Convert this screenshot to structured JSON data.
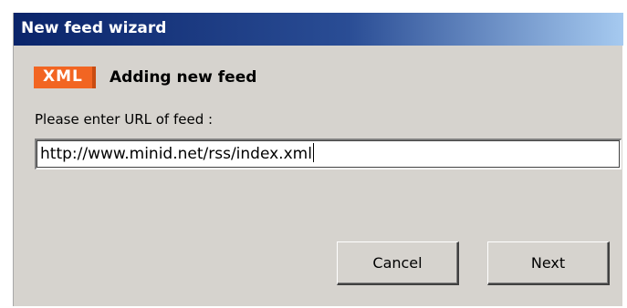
{
  "window": {
    "title": "New feed wizard"
  },
  "header": {
    "badge_text": "XML",
    "heading": "Adding new feed",
    "badge_color": "#f26522"
  },
  "form": {
    "url_label": "Please enter URL of feed :",
    "url_value": "http://www.minid.net/rss/index.xml"
  },
  "buttons": {
    "cancel_label": "Cancel",
    "next_label": "Next"
  },
  "colors": {
    "titlebar_start": "#0a246a",
    "titlebar_end": "#a6caf0",
    "dialog_bg": "#d6d3ce"
  }
}
